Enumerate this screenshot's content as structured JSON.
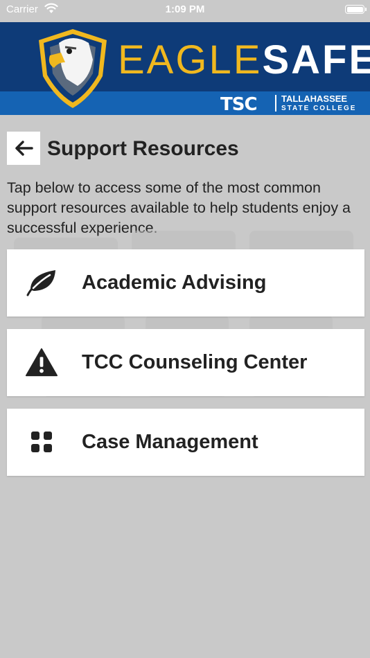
{
  "status_bar": {
    "carrier": "Carrier",
    "time": "1:09 PM"
  },
  "banner": {
    "title_part1": "EAGLE",
    "title_part2": "SAFE",
    "school_abbrev": "TSC",
    "school_name": "TALLAHASSEE",
    "school_sub": "STATE COLLEGE",
    "colors": {
      "navy": "#0e3b78",
      "blue": "#1563b3",
      "gold": "#f0b81f"
    }
  },
  "header": {
    "back_icon": "arrow-left-icon",
    "title": "Support Resources"
  },
  "intro_text": "Tap below to access some of the most common support resources available to help students enjoy a successful experience.",
  "resources": [
    {
      "label": "Academic Advising",
      "icon": "leaf-icon"
    },
    {
      "label": "TCC Counseling Center",
      "icon": "warning-icon"
    },
    {
      "label": "Case Management",
      "icon": "grid-icon"
    }
  ]
}
